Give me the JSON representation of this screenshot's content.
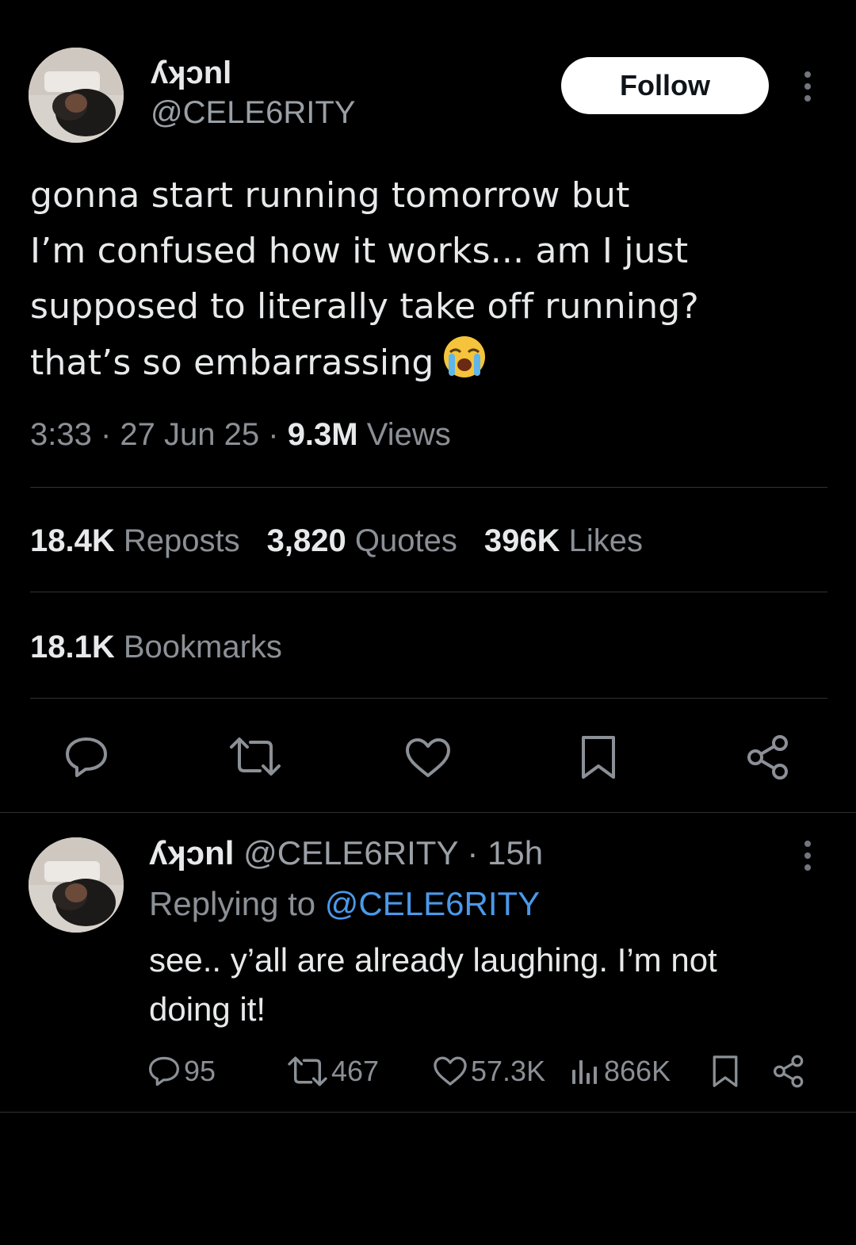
{
  "tweet": {
    "author": {
      "display_name": "ʎʞɔnl",
      "handle": "@CELE6RITY"
    },
    "follow_label": "Follow",
    "text_lines": [
      "gonna start running tomorrow but",
      "I’m confused how it works... am I just",
      "supposed to literally take off running?",
      "that’s so embarrassing"
    ],
    "emoji": "loudly-crying-face",
    "time": "3:33",
    "date": "27 Jun 25",
    "views_count": "9.3M",
    "views_label": "Views",
    "reposts_count": "18.4K",
    "reposts_label": "Reposts",
    "quotes_count": "3,820",
    "quotes_label": "Quotes",
    "likes_count": "396K",
    "likes_label": "Likes",
    "bookmarks_count": "18.1K",
    "bookmarks_label": "Bookmarks",
    "actions": [
      "reply-icon",
      "repost-icon",
      "like-icon",
      "bookmark-icon",
      "share-icon"
    ]
  },
  "reply": {
    "author": {
      "display_name": "ʎʞɔnl",
      "handle": "@CELE6RITY",
      "time": "15h"
    },
    "replying_prefix": "Replying to",
    "replying_to": "@CELE6RITY",
    "text_lines": [
      "see.. y’all are already laughing. I’m not",
      "doing it!"
    ],
    "replies": "95",
    "reposts": "467",
    "likes": "57.3K",
    "views": "866K"
  },
  "colors": {
    "background": "#000000",
    "primary_text": "#e7e9ea",
    "secondary_text": "#8b9096",
    "divider": "#2f3336",
    "link": "#4a99e9",
    "follow_bg": "#ffffff"
  }
}
